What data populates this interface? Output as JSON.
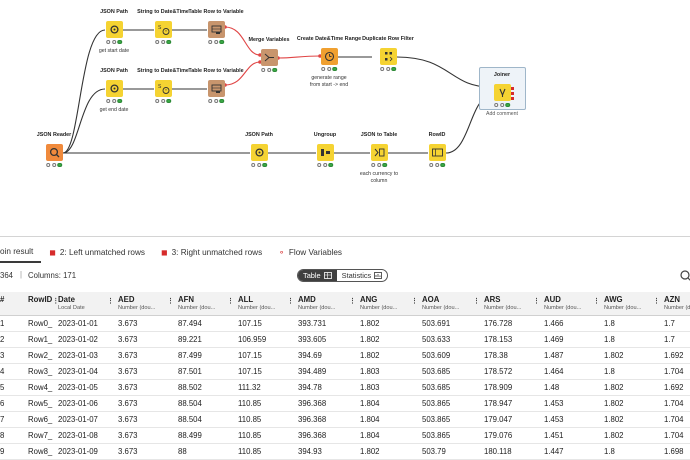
{
  "workflow": {
    "nodes": [
      {
        "id": "jp1",
        "title": "JSON Path",
        "color": "#f5d332",
        "icon": "json-path-icon",
        "annotation": "get start date"
      },
      {
        "id": "sdt1",
        "title": "String to Date&Time",
        "color": "#f5d332",
        "icon": "string-to-datetime-icon",
        "annotation": ""
      },
      {
        "id": "trv1",
        "title": "Table Row to Variable",
        "color": "#c8956d",
        "icon": "table-row-to-variable-icon",
        "annotation": ""
      },
      {
        "id": "jp2",
        "title": "JSON Path",
        "color": "#f5d332",
        "icon": "json-path-icon",
        "annotation": "get end date"
      },
      {
        "id": "sdt2",
        "title": "String to Date&Time",
        "color": "#f5d332",
        "icon": "string-to-datetime-icon",
        "annotation": ""
      },
      {
        "id": "trv2",
        "title": "Table Row to Variable",
        "color": "#c8956d",
        "icon": "table-row-to-variable-icon",
        "annotation": ""
      },
      {
        "id": "merge",
        "title": "Merge Variables",
        "color": "#c8956d",
        "icon": "merge-variables-icon",
        "annotation": ""
      },
      {
        "id": "cdr",
        "title": "Create Date&Time Range",
        "color": "#f0a030",
        "icon": "create-datetime-range-icon",
        "annotation": "generate range\nfrom start -> end"
      },
      {
        "id": "drf",
        "title": "Duplicate Row Filter",
        "color": "#f5d332",
        "icon": "duplicate-row-filter-icon",
        "annotation": ""
      },
      {
        "id": "joiner",
        "title": "Joiner",
        "color": "#f5d332",
        "icon": "joiner-icon",
        "annotation": "Add comment"
      },
      {
        "id": "jr",
        "title": "JSON Reader",
        "color": "#f08a3c",
        "icon": "json-reader-icon",
        "annotation": ""
      },
      {
        "id": "jp3",
        "title": "JSON Path",
        "color": "#f5d332",
        "icon": "json-path-icon",
        "annotation": ""
      },
      {
        "id": "ungroup",
        "title": "Ungroup",
        "color": "#f5d332",
        "icon": "ungroup-icon",
        "annotation": ""
      },
      {
        "id": "jtt",
        "title": "JSON to Table",
        "color": "#f5d332",
        "icon": "json-to-table-icon",
        "annotation": "each currency to\ncolumn"
      },
      {
        "id": "rowid",
        "title": "RowID",
        "color": "#f5d332",
        "icon": "rowid-icon",
        "annotation": ""
      }
    ]
  },
  "panel": {
    "tabs": [
      {
        "label": "oin result",
        "icon": "",
        "active": true
      },
      {
        "label": "2: Left unmatched rows",
        "icon": "joiner-port-icon",
        "active": false
      },
      {
        "label": "3: Right unmatched rows",
        "icon": "joiner-port-icon",
        "active": false
      },
      {
        "label": "Flow Variables",
        "icon": "flow-variable-icon",
        "active": false
      }
    ],
    "rows_label": "364",
    "columns_label": "Columns: 171",
    "view_toggle": {
      "table": "Table",
      "statistics": "Statistics",
      "selected": "Table"
    }
  },
  "table": {
    "columns": [
      {
        "name": "#",
        "type": ""
      },
      {
        "name": "RowID",
        "type": ""
      },
      {
        "name": "Date",
        "type": "Local Date"
      },
      {
        "name": "AED",
        "type": "Number (dou..."
      },
      {
        "name": "AFN",
        "type": "Number (dou..."
      },
      {
        "name": "ALL",
        "type": "Number (dou..."
      },
      {
        "name": "AMD",
        "type": "Number (dou..."
      },
      {
        "name": "ANG",
        "type": "Number (dou..."
      },
      {
        "name": "AOA",
        "type": "Number (dou..."
      },
      {
        "name": "ARS",
        "type": "Number (dou..."
      },
      {
        "name": "AUD",
        "type": "Number (dou..."
      },
      {
        "name": "AWG",
        "type": "Number (dou..."
      },
      {
        "name": "AZN",
        "type": "Number (dou..."
      }
    ],
    "rows": [
      [
        "1",
        "Row0_",
        "2023-01-01",
        "3.673",
        "87.494",
        "107.15",
        "393.731",
        "1.802",
        "503.691",
        "176.728",
        "1.466",
        "1.8",
        "1.7"
      ],
      [
        "2",
        "Row1_",
        "2023-01-02",
        "3.673",
        "89.221",
        "106.959",
        "393.605",
        "1.802",
        "503.633",
        "178.153",
        "1.469",
        "1.8",
        "1.7"
      ],
      [
        "3",
        "Row2_",
        "2023-01-03",
        "3.673",
        "87.499",
        "107.15",
        "394.69",
        "1.802",
        "503.609",
        "178.38",
        "1.487",
        "1.802",
        "1.692"
      ],
      [
        "4",
        "Row3_",
        "2023-01-04",
        "3.673",
        "87.501",
        "107.15",
        "394.489",
        "1.803",
        "503.685",
        "178.572",
        "1.464",
        "1.8",
        "1.704"
      ],
      [
        "5",
        "Row4_",
        "2023-01-05",
        "3.673",
        "88.502",
        "111.32",
        "394.78",
        "1.803",
        "503.685",
        "178.909",
        "1.48",
        "1.802",
        "1.692"
      ],
      [
        "6",
        "Row5_",
        "2023-01-06",
        "3.673",
        "88.504",
        "110.85",
        "396.368",
        "1.804",
        "503.865",
        "178.947",
        "1.453",
        "1.802",
        "1.704"
      ],
      [
        "7",
        "Row6_",
        "2023-01-07",
        "3.673",
        "88.504",
        "110.85",
        "396.368",
        "1.804",
        "503.865",
        "179.047",
        "1.453",
        "1.802",
        "1.704"
      ],
      [
        "8",
        "Row7_",
        "2023-01-08",
        "3.673",
        "88.499",
        "110.85",
        "396.368",
        "1.804",
        "503.865",
        "179.076",
        "1.451",
        "1.802",
        "1.704"
      ],
      [
        "9",
        "Row8_",
        "2023-01-09",
        "3.673",
        "88",
        "110.85",
        "394.93",
        "1.802",
        "503.79",
        "180.118",
        "1.447",
        "1.8",
        "1.698"
      ]
    ]
  }
}
